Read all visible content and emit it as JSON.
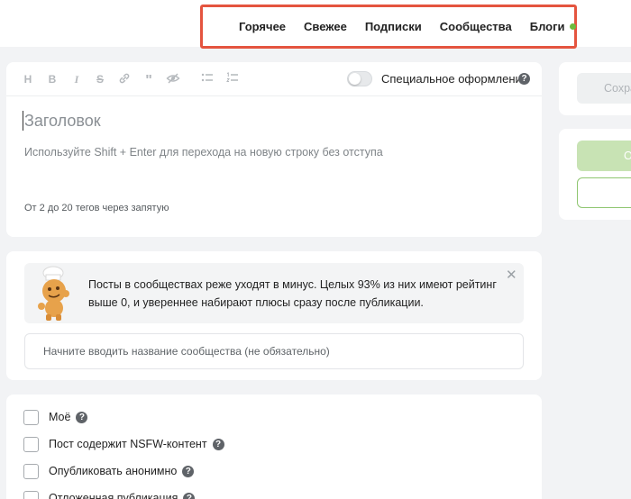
{
  "nav": {
    "items": [
      "Горячее",
      "Свежее",
      "Подписки",
      "Сообщества",
      "Блоги"
    ],
    "blogs_dot_color": "#6dbb3c",
    "highlight_color": "#e4543f"
  },
  "editor": {
    "toolbar_icons": [
      "heading-icon",
      "bold-icon",
      "italic-icon",
      "strikethrough-icon",
      "link-icon",
      "quote-icon",
      "hide-icon",
      "bullet-list-icon",
      "numbered-list-icon"
    ],
    "special_design_label": "Специальное оформление",
    "special_design_on": false,
    "title_placeholder": "Заголовок",
    "body_placeholder": "Используйте Shift + Enter для перехода на новую строку без отступа",
    "tags_placeholder": "От 2 до 20 тегов через запятую"
  },
  "community": {
    "notice_text": "Посты в сообществах реже уходят в минус. Целых 93% из них имеют рейтинг выше 0, и увереннее набирают плюсы сразу после публикации.",
    "input_placeholder": "Начните вводить название сообщества (не обязательно)"
  },
  "options": [
    {
      "label": "Моё",
      "checked": false
    },
    {
      "label": "Пост содержит NSFW-контент",
      "checked": false
    },
    {
      "label": "Опубликовать анонимно",
      "checked": false
    },
    {
      "label": "Отложенная публикация",
      "checked": false
    }
  ],
  "sidebar": {
    "save_label": "Сохра",
    "publish_label": "О",
    "publish_color": "#c8e3b4"
  }
}
